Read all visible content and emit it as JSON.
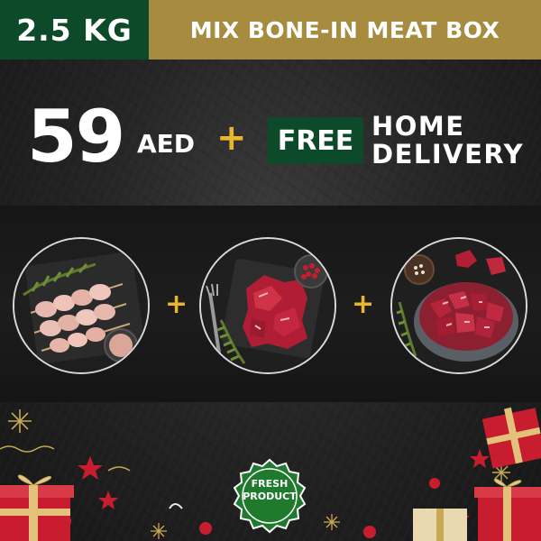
{
  "header": {
    "weight": "2.5 KG",
    "title": "MIX BONE-IN MEAT BOX"
  },
  "offer": {
    "price": "59",
    "currency": "AED",
    "plus": "+",
    "free_label": "FREE",
    "delivery_line1": "HOME",
    "delivery_line2": "DELIVERY"
  },
  "products": [
    {
      "icon": "chicken-skewers-icon"
    },
    {
      "icon": "beef-cubes-icon"
    },
    {
      "icon": "meat-bowl-icon"
    }
  ],
  "connectors": [
    "+",
    "+"
  ],
  "badge": {
    "line1": "FRESH",
    "line2": "PRODUCT"
  },
  "colors": {
    "brand_green": "#0c4a2a",
    "gold": "#a78b3f",
    "accent_yellow": "#e9b52c",
    "background": "#2a2a2a"
  }
}
